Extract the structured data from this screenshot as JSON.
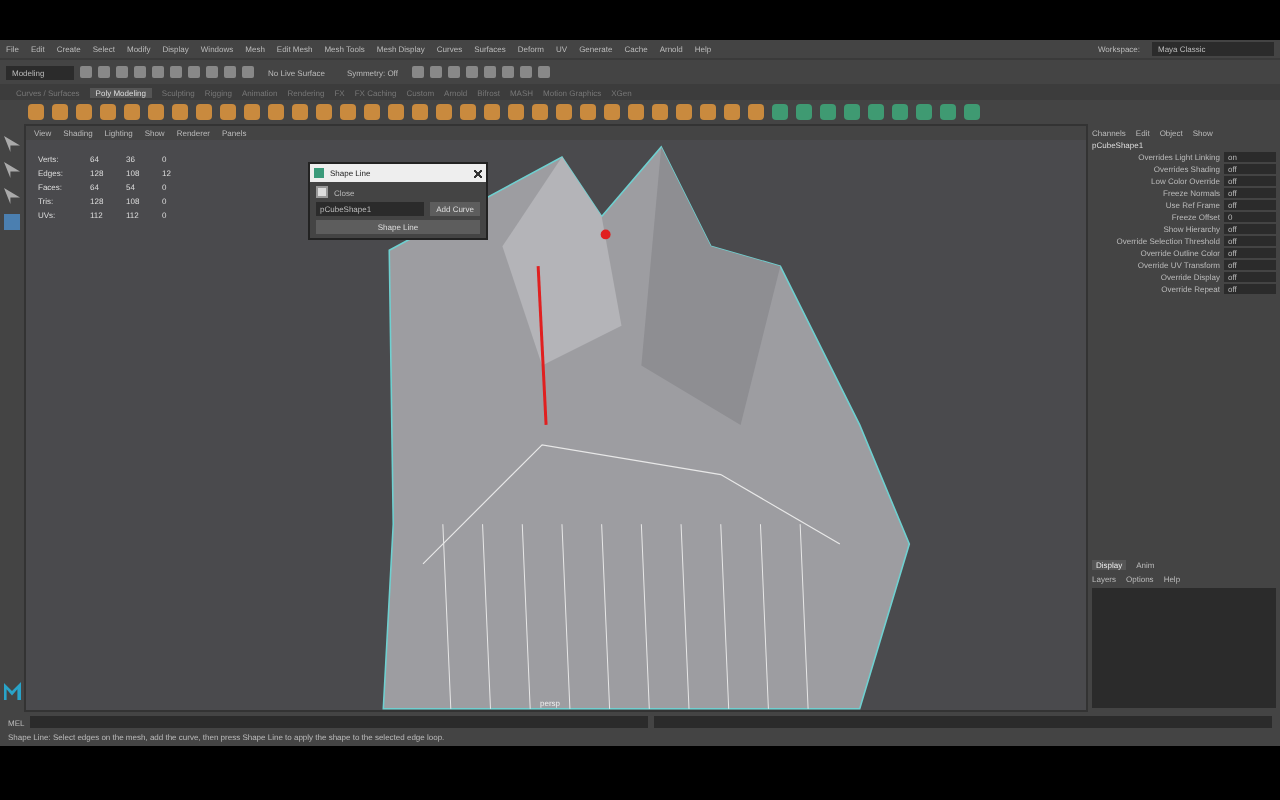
{
  "menu_bar": [
    "File",
    "Edit",
    "Create",
    "Select",
    "Modify",
    "Display",
    "Windows",
    "Mesh",
    "Edit Mesh",
    "Mesh Tools",
    "Mesh Display",
    "Curves",
    "Surfaces",
    "Deform",
    "UV",
    "Generate",
    "Cache",
    "Arnold",
    "Help"
  ],
  "workspace": {
    "label": "Workspace:",
    "value": "Maya Classic"
  },
  "status_line": {
    "mode": "Modeling",
    "live_surface": "No Live Surface",
    "symmetry": "Symmetry: Off"
  },
  "shelf_tabs": [
    {
      "label": "Curves / Surfaces",
      "selected": false
    },
    {
      "label": "Poly Modeling",
      "selected": true
    },
    {
      "label": "Sculpting",
      "selected": false
    },
    {
      "label": "Rigging",
      "selected": false
    },
    {
      "label": "Animation",
      "selected": false
    },
    {
      "label": "Rendering",
      "selected": false
    },
    {
      "label": "FX",
      "selected": false
    },
    {
      "label": "FX Caching",
      "selected": false
    },
    {
      "label": "Custom",
      "selected": false
    },
    {
      "label": "Arnold",
      "selected": false
    },
    {
      "label": "Bifrost",
      "selected": false
    },
    {
      "label": "MASH",
      "selected": false
    },
    {
      "label": "Motion Graphics",
      "selected": false
    },
    {
      "label": "XGen",
      "selected": false
    }
  ],
  "viewport": {
    "menu": [
      "View",
      "Shading",
      "Lighting",
      "Show",
      "Renderer",
      "Panels"
    ],
    "hud": [
      {
        "name": "Verts:",
        "values": [
          "64",
          "36",
          "0"
        ]
      },
      {
        "name": "Edges:",
        "values": [
          "128",
          "108",
          "12"
        ]
      },
      {
        "name": "Faces:",
        "values": [
          "64",
          "54",
          "0"
        ]
      },
      {
        "name": "Tris:",
        "values": [
          "128",
          "108",
          "0"
        ]
      },
      {
        "name": "UVs:",
        "values": [
          "112",
          "112",
          "0"
        ]
      }
    ],
    "camera": "persp"
  },
  "dialog": {
    "title": "Shape Line",
    "checkbox": {
      "label": "Close",
      "checked": true
    },
    "field": "pCubeShape1",
    "add_button": "Add Curve",
    "main_button": "Shape Line"
  },
  "channel_box": {
    "tabs": [
      "Channels",
      "Edit",
      "Object",
      "Show"
    ],
    "node": "pCubeShape1",
    "rows": [
      {
        "name": "Overrides Light Linking",
        "value": "on"
      },
      {
        "name": "Overrides Shading",
        "value": "off"
      },
      {
        "name": "Low Color Override",
        "value": "off"
      },
      {
        "name": "Freeze Normals",
        "value": "off"
      },
      {
        "name": "Use Ref Frame",
        "value": "off"
      },
      {
        "name": "Freeze Offset",
        "value": "0"
      },
      {
        "name": "Show Hierarchy",
        "value": "off"
      },
      {
        "name": "Override Selection Threshold",
        "value": "off"
      },
      {
        "name": "Override Outline Color",
        "value": "off"
      },
      {
        "name": "Override UV Transform",
        "value": "off"
      },
      {
        "name": "Override Display",
        "value": "off"
      },
      {
        "name": "Override Repeat",
        "value": "off"
      }
    ]
  },
  "layers": {
    "tabs": [
      {
        "label": "Display",
        "selected": true
      },
      {
        "label": "Anim",
        "selected": false
      }
    ],
    "menu": [
      "Layers",
      "Options",
      "Help"
    ]
  },
  "command_line": {
    "label": "MEL"
  },
  "help_line": "Shape Line: Select edges on the mesh, add the curve, then press Shape Line to apply the shape to the selected edge loop."
}
